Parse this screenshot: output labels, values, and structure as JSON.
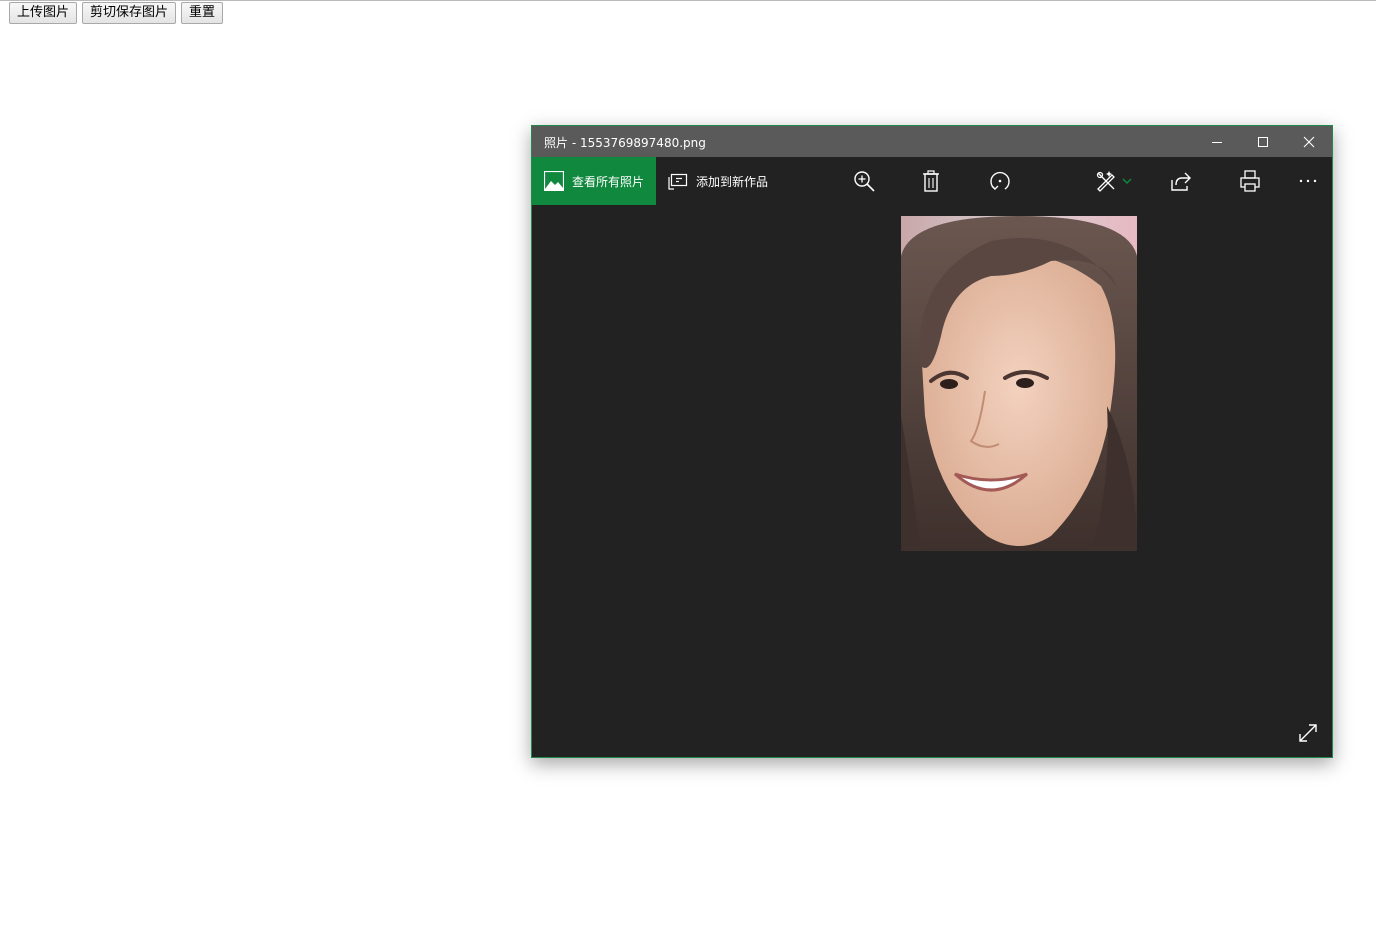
{
  "page": {
    "buttons": [
      {
        "label": "上传图片"
      },
      {
        "label": "剪切保存图片"
      },
      {
        "label": "重置"
      }
    ]
  },
  "window": {
    "title": "照片 - 1553769897480.png",
    "accent_color": "#10893e",
    "titlebar_color": "#5a5a5a",
    "background_color": "#222222",
    "controls": [
      "minimize-icon",
      "maximize-icon",
      "close-icon"
    ]
  },
  "toolbar": {
    "view_all_label": "查看所有照片",
    "add_creation_label": "添加到新作品",
    "icons": [
      "zoom-in-icon",
      "delete-icon",
      "rotate-icon",
      "edit-icon",
      "chevron-down-icon",
      "share-icon",
      "print-icon",
      "more-icon"
    ]
  },
  "content": {
    "image": "portrait-photo",
    "expand_icon": "fullscreen-expand-icon"
  }
}
